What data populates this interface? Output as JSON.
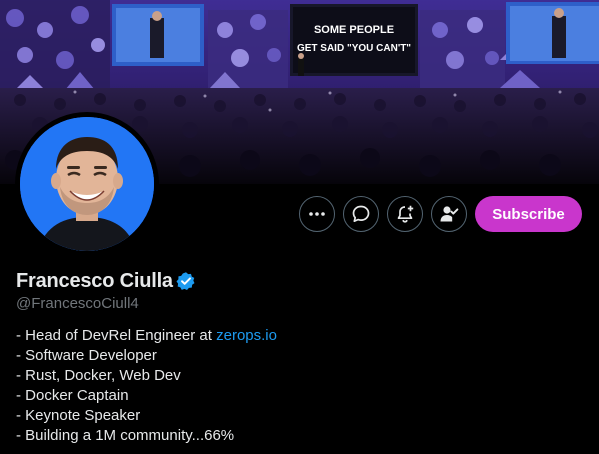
{
  "profile": {
    "display_name": "Francesco Ciulla",
    "handle": "@FrancescoCiull4",
    "verified_icon": "verified-badge-icon",
    "banner_slide_line1": "SOME PEOPLE",
    "banner_slide_line2": "GET SAID \"YOU CAN'T\""
  },
  "actions": {
    "more_icon": "more-dots-icon",
    "message_icon": "message-bubble-icon",
    "notify_icon": "bell-plus-icon",
    "follow_icon": "person-check-icon",
    "subscribe_label": "Subscribe"
  },
  "bio": {
    "line1_prefix": "- Head of DevRel Engineer at ",
    "line1_link": "zerops.io",
    "lines": [
      "- Software Developer",
      "- Rust, Docker, Web Dev",
      "- Docker Captain",
      "- Keynote Speaker",
      "- Building a 1M community...66%"
    ]
  },
  "colors": {
    "background": "#000000",
    "accent_subscribe": "#c936cc",
    "link": "#1d9bf0",
    "secondary_text": "#71767b",
    "verified": "#1d9bf0"
  }
}
